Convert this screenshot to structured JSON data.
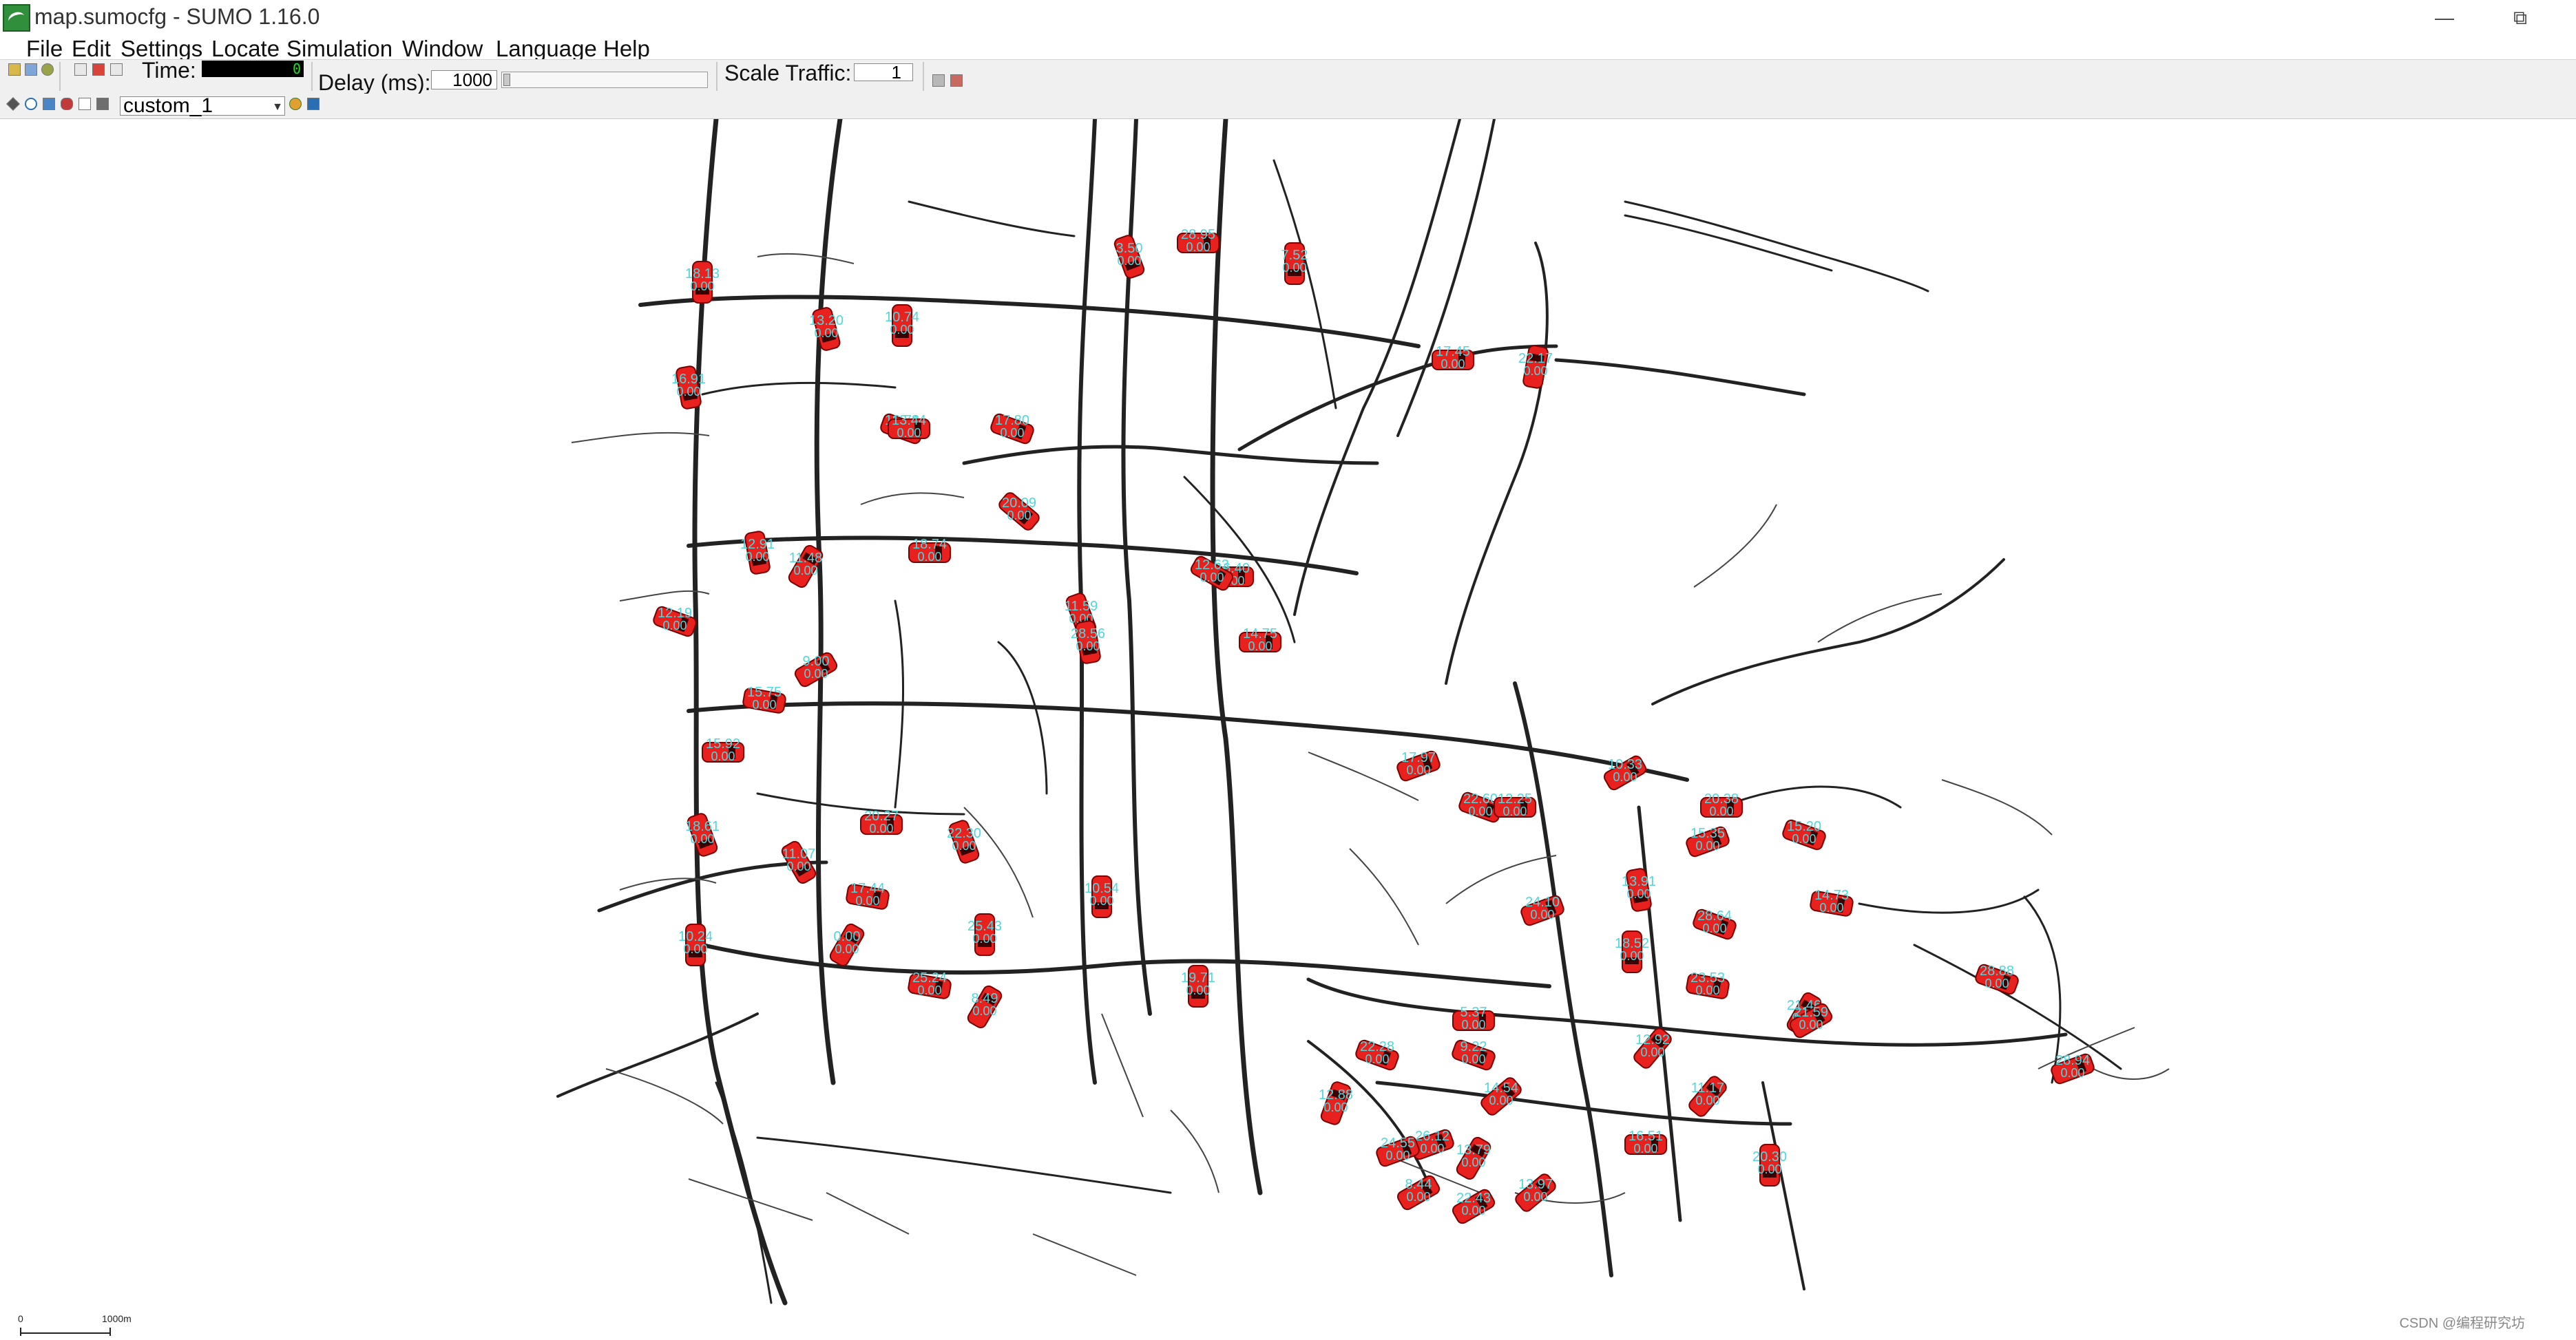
{
  "window": {
    "title": "map.sumocfg - SUMO 1.16.0",
    "minimize_icon": "minimize-icon",
    "restore_icon": "restore-icon",
    "minimize_glyph": "—",
    "restore_glyph": "⧉"
  },
  "menu": {
    "items": [
      "File",
      "Edit",
      "Settings",
      "Locate",
      "Simulation",
      "Window",
      "Language",
      "Help"
    ]
  },
  "toolbar": {
    "time_label": "Time:",
    "time_value": "0",
    "delay_label": "Delay (ms):",
    "delay_value": "1000",
    "scale_label": "Scale Traffic:",
    "scale_value": "1"
  },
  "view": {
    "scheme": "custom_1"
  },
  "map": {
    "scale_start": "0",
    "scale_end": "1000m",
    "vehicle_color": "#e8211f",
    "label_color": "#4fd7dc",
    "road_color": "#222222",
    "vehicles": [
      {
        "speed": "18.13",
        "value": "0.00"
      },
      {
        "speed": "16.91",
        "value": "0.00"
      },
      {
        "speed": "13.20",
        "value": "0.00"
      },
      {
        "speed": "10.74",
        "value": "0.00"
      },
      {
        "speed": "12.19",
        "value": "0.00"
      },
      {
        "speed": "11.48",
        "value": "0.00"
      },
      {
        "speed": "15.75",
        "value": "0.00"
      },
      {
        "speed": "15.92",
        "value": "0.00"
      },
      {
        "speed": "18.61",
        "value": "0.00"
      },
      {
        "speed": "10.24",
        "value": "0.00"
      },
      {
        "speed": "12.91",
        "value": "0.00"
      },
      {
        "speed": "18.74",
        "value": "0.00"
      },
      {
        "speed": "9.00",
        "value": "0.00"
      },
      {
        "speed": "11.07",
        "value": "0.00"
      },
      {
        "speed": "20.27",
        "value": "0.00"
      },
      {
        "speed": "17.44",
        "value": "0.00"
      },
      {
        "speed": "0.00",
        "value": "0.00"
      },
      {
        "speed": "25.24",
        "value": "0.00"
      },
      {
        "speed": "8.49",
        "value": "0.00"
      },
      {
        "speed": "22.30",
        "value": "0.00"
      },
      {
        "speed": "25.43",
        "value": "0.00"
      },
      {
        "speed": "16.78",
        "value": "0.00"
      },
      {
        "speed": "20.09",
        "value": "0.00"
      },
      {
        "speed": "17.80",
        "value": "0.00"
      },
      {
        "speed": "13.44",
        "value": "0.00"
      },
      {
        "speed": "28.95",
        "value": "0.00"
      },
      {
        "speed": "3.50",
        "value": "0.00"
      },
      {
        "speed": "7.52",
        "value": "0.00"
      },
      {
        "speed": "10.54",
        "value": "0.00"
      },
      {
        "speed": "19.71",
        "value": "0.00"
      },
      {
        "speed": "16.40",
        "value": "0.00"
      },
      {
        "speed": "12.63",
        "value": "0.00"
      },
      {
        "speed": "11.59",
        "value": "0.00"
      },
      {
        "speed": "14.75",
        "value": "0.00"
      },
      {
        "speed": "22.28",
        "value": "0.00"
      },
      {
        "speed": "17.45",
        "value": "0.00"
      },
      {
        "speed": "22.17",
        "value": "0.00"
      },
      {
        "speed": "28.56",
        "value": "0.00"
      },
      {
        "speed": "17.97",
        "value": "0.00"
      },
      {
        "speed": "22.60",
        "value": "0.00"
      },
      {
        "speed": "24.10",
        "value": "0.00"
      },
      {
        "speed": "26.12",
        "value": "0.00"
      },
      {
        "speed": "16.51",
        "value": "0.00"
      },
      {
        "speed": "23.53",
        "value": "0.00"
      },
      {
        "speed": "10.33",
        "value": "0.00"
      },
      {
        "speed": "15.20",
        "value": "0.00"
      },
      {
        "speed": "11.17",
        "value": "0.00"
      },
      {
        "speed": "5.37",
        "value": "0.00"
      },
      {
        "speed": "9.22",
        "value": "0.00"
      },
      {
        "speed": "14.54",
        "value": "0.00"
      },
      {
        "speed": "24.55",
        "value": "0.00"
      },
      {
        "speed": "8.44",
        "value": "0.00"
      },
      {
        "speed": "12.88",
        "value": "0.00"
      },
      {
        "speed": "13.79",
        "value": "0.00"
      },
      {
        "speed": "22.43",
        "value": "0.00"
      },
      {
        "speed": "13.97",
        "value": "0.00"
      },
      {
        "speed": "28.64",
        "value": "0.00"
      },
      {
        "speed": "18.52",
        "value": "0.00"
      },
      {
        "speed": "13.91",
        "value": "0.00"
      },
      {
        "speed": "21.46",
        "value": "0.00"
      },
      {
        "speed": "14.73",
        "value": "0.00"
      },
      {
        "speed": "20.38",
        "value": "0.00"
      },
      {
        "speed": "12.25",
        "value": "0.00"
      },
      {
        "speed": "15.35",
        "value": "0.00"
      },
      {
        "speed": "12.92",
        "value": "0.00"
      },
      {
        "speed": "28.94",
        "value": "0.00"
      },
      {
        "speed": "20.30",
        "value": "0.00"
      },
      {
        "speed": "21.59",
        "value": "0.00"
      },
      {
        "speed": "28.88",
        "value": "0.00"
      }
    ]
  },
  "watermark": "CSDN @编程研究坊"
}
